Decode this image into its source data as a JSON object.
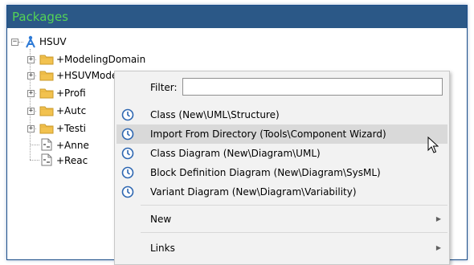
{
  "panel": {
    "title": "Packages"
  },
  "tree": {
    "root": {
      "label": "HSUV",
      "expander": "−"
    },
    "children": [
      {
        "label": "+ModelingDomain",
        "expander": "+",
        "kind": "package"
      },
      {
        "label": "+HSUVModel",
        "expander": "+",
        "kind": "package"
      },
      {
        "label": "+Profi",
        "expander": "+",
        "kind": "package"
      },
      {
        "label": "+Autc",
        "expander": "+",
        "kind": "package"
      },
      {
        "label": "+Testi",
        "expander": "+",
        "kind": "package"
      },
      {
        "label": "+Anne",
        "kind": "diagram"
      },
      {
        "label": "+Reac",
        "kind": "diagram"
      }
    ]
  },
  "context_menu": {
    "filter_label": "Filter:",
    "filter_value": "",
    "recent_items": [
      {
        "label": "Class (New\\UML\\Structure)",
        "icon": "clock-icon",
        "highlighted": false
      },
      {
        "label": "Import From Directory (Tools\\Component Wizard)",
        "icon": "clock-icon",
        "highlighted": true
      },
      {
        "label": "Class Diagram (New\\Diagram\\UML)",
        "icon": "clock-icon",
        "highlighted": false
      },
      {
        "label": "Block Definition Diagram (New\\Diagram\\SysML)",
        "icon": "clock-icon",
        "highlighted": false
      },
      {
        "label": "Variant Diagram (New\\Diagram\\Variability)",
        "icon": "clock-icon",
        "highlighted": false
      }
    ],
    "submenus": [
      {
        "label": "New",
        "arrow": "▶"
      },
      {
        "label": "Links",
        "arrow": "▶"
      }
    ]
  },
  "colors": {
    "header_bg": "#2b5887",
    "header_text": "#54d356",
    "clock_icon": "#2e67b1",
    "folder": "#f2c24f",
    "highlight": "#d9d9d9"
  }
}
